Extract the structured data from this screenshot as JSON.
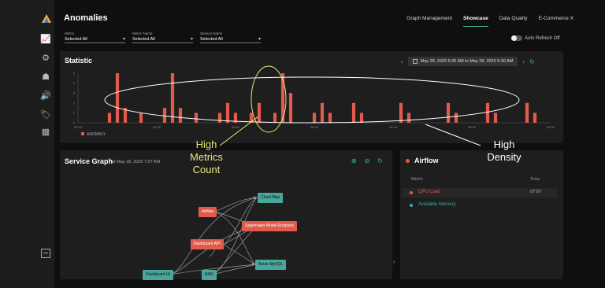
{
  "header": {
    "title": "Anomalies",
    "tabs": [
      {
        "label": "Graph Management"
      },
      {
        "label": "Showcase"
      },
      {
        "label": "Data Quality"
      },
      {
        "label": "E-Commerce X"
      }
    ],
    "active_tab": "Showcase"
  },
  "filters": [
    {
      "label": "Metric",
      "value": "Selected All"
    },
    {
      "label": "Metric Name",
      "value": "Selected All"
    },
    {
      "label": "Service Name",
      "value": "Selected All"
    }
  ],
  "auto_refresh": {
    "label": "Auto Refresh Off",
    "on": false
  },
  "statistic": {
    "title": "Statistic",
    "date_range": "May 28, 2020 5:30 AM to May 28, 2020 6:30 AM",
    "legend": "ANOMALY"
  },
  "chart_data": {
    "type": "bar",
    "series": [
      {
        "name": "ANOMALY",
        "color": "#e15b4c"
      }
    ],
    "x_ticks": [
      "05:30",
      "05:40",
      "05:50",
      "06:00",
      "06:10",
      "06:20",
      "06:30"
    ],
    "y_ticks": [
      "0",
      "1",
      "2",
      "3",
      "4",
      "5"
    ],
    "ylim": [
      0,
      5
    ],
    "bars": [
      {
        "x": "05:34",
        "y": 1
      },
      {
        "x": "05:35",
        "y": 5
      },
      {
        "x": "05:36",
        "y": 1.5
      },
      {
        "x": "05:38",
        "y": 1
      },
      {
        "x": "05:41",
        "y": 1.5
      },
      {
        "x": "05:42",
        "y": 5
      },
      {
        "x": "05:43",
        "y": 1.5
      },
      {
        "x": "05:45",
        "y": 1
      },
      {
        "x": "05:48",
        "y": 1
      },
      {
        "x": "05:49",
        "y": 2
      },
      {
        "x": "05:50",
        "y": 1
      },
      {
        "x": "05:52",
        "y": 1
      },
      {
        "x": "05:53",
        "y": 2
      },
      {
        "x": "05:55",
        "y": 1
      },
      {
        "x": "05:56",
        "y": 5
      },
      {
        "x": "05:57",
        "y": 3
      },
      {
        "x": "06:00",
        "y": 1
      },
      {
        "x": "06:01",
        "y": 2
      },
      {
        "x": "06:02",
        "y": 1
      },
      {
        "x": "06:05",
        "y": 2
      },
      {
        "x": "06:06",
        "y": 1
      },
      {
        "x": "06:11",
        "y": 2
      },
      {
        "x": "06:12",
        "y": 1
      },
      {
        "x": "06:17",
        "y": 2
      },
      {
        "x": "06:18",
        "y": 1
      },
      {
        "x": "06:22",
        "y": 2
      },
      {
        "x": "06:23",
        "y": 1
      },
      {
        "x": "06:27",
        "y": 2
      },
      {
        "x": "06:28",
        "y": 1
      }
    ],
    "grid": false,
    "legend_position": "bottom-left"
  },
  "service_graph": {
    "title": "Service Graph",
    "subtitle": "at May 28, 2020 7:07 AM",
    "nodes": [
      {
        "id": "cloudmap",
        "label": "Cloud Map",
        "color": "green"
      },
      {
        "id": "airflow",
        "label": "Airflow",
        "color": "red"
      },
      {
        "id": "sagemaker",
        "label": "Sagemaker Model Endpoint",
        "color": "red"
      },
      {
        "id": "dashapi",
        "label": "Dashboard API",
        "color": "red"
      },
      {
        "id": "azure",
        "label": "Azure MySQL",
        "color": "green"
      },
      {
        "id": "dashui",
        "label": "Dashboard UI",
        "color": "green"
      },
      {
        "id": "enn",
        "label": "ENN",
        "color": "green"
      }
    ]
  },
  "airflow": {
    "title": "Airflow",
    "col_metric": "Metric",
    "col_time": "Time",
    "rows": [
      {
        "name": "CPU Load",
        "time": "07:07",
        "status": "anomaly"
      },
      {
        "name": "Available Memory",
        "time": "",
        "status": "normal"
      }
    ]
  },
  "annotations": [
    {
      "text": "High Metrics Count"
    },
    {
      "text": "High Density"
    }
  ],
  "colors": {
    "accent": "#3fb8a0",
    "anomaly": "#e15b4c",
    "annot_yellow": "#e8e87a",
    "annot_white": "#ffffff"
  }
}
